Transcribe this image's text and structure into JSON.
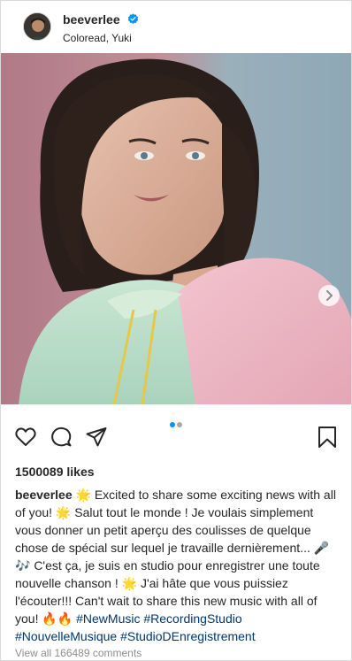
{
  "post": {
    "username": "beeverlee",
    "location": "Coloread, Yuki",
    "verified_icon": "verified-badge-icon",
    "image_count": 2,
    "active_image_index": 0,
    "colors": {
      "accent": "#0095f6",
      "link": "#00376b",
      "muted": "#8e8e8e",
      "text": "#262626"
    }
  },
  "actions": {
    "like_icon": "heart-icon",
    "comment_icon": "comment-icon",
    "share_icon": "share-icon",
    "save_icon": "bookmark-icon"
  },
  "likes": "1500089 likes",
  "caption": {
    "username": "beeverlee",
    "text_part1": " 🌟 Excited to share some exciting news with all of you! 🌟 Salut tout le monde ! Je voulais simplement vous donner un petit aperçu des coulisses de quelque chose de spécial sur lequel je travaille dernièrement... 🎤🎶 C'est ça, je suis en studio pour enregistrer une toute nouvelle chanson ! 🌟 J'ai hâte que vous puissiez l'écouter!!! Can't wait to share this new music with all of you! 🔥🔥 ",
    "hashtags": [
      "#NewMusic",
      "#RecordingStudio",
      "#NouvelleMusique",
      "#StudioDEnregistrement"
    ]
  },
  "comments_link": "View all 166489 comments"
}
